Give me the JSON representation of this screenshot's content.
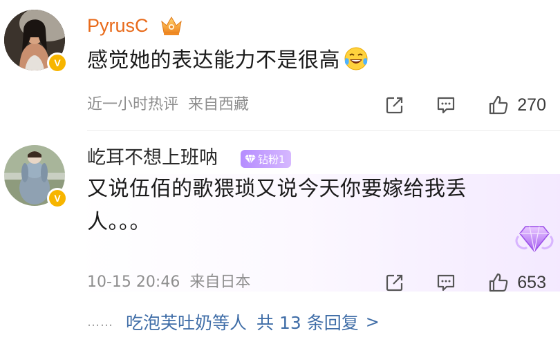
{
  "comments": [
    {
      "username": "PyrusC",
      "text": "感觉她的表达能力不是很高",
      "time": "近一小时热评",
      "location": "来自西藏",
      "likes": "270",
      "verified_badge": "V"
    },
    {
      "username": "屹耳不想上班呐",
      "fan_badge": "钻粉1",
      "text": "又说伍佰的歌猥琐又说今天你要嫁给我丢人。。。",
      "time": "10-15 20:46",
      "location": "来自日本",
      "likes": "653",
      "verified_badge": "V"
    }
  ],
  "replies_bar": {
    "dots": "……",
    "who": "吃泡芙吐奶等人",
    "count_text": "共 13 条回复",
    "chevron": ">"
  },
  "colors": {
    "vip_name": "#e86a1a",
    "link": "#3f6da7",
    "meta": "#8e8e8e",
    "verified": "#f7b500",
    "fan_badge": "#b58cff"
  },
  "icons": [
    "crown-icon",
    "laugh-cry-emoji",
    "share-icon",
    "comment-icon",
    "thumbs-up-icon",
    "diamond-icon"
  ]
}
